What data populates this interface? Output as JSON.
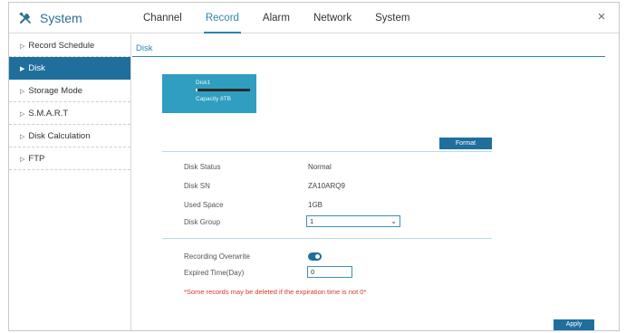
{
  "header": {
    "app_title": "System",
    "icon": "tools-icon",
    "nav": [
      "Channel",
      "Record",
      "Alarm",
      "Network",
      "System"
    ],
    "active_nav": "Record",
    "close_symbol": "×"
  },
  "sidebar": {
    "items": [
      {
        "label": "Record Schedule",
        "active": false
      },
      {
        "label": "Disk",
        "active": true
      },
      {
        "label": "Storage Mode",
        "active": false
      },
      {
        "label": "S.M.A.R.T",
        "active": false
      },
      {
        "label": "Disk Calculation",
        "active": false
      },
      {
        "label": "FTP",
        "active": false
      }
    ]
  },
  "main": {
    "section_title": "Disk",
    "disk_card": {
      "name": "Disk1",
      "capacity": "Capacity 8TB",
      "used_fraction": 0.04
    },
    "format_label": "Format",
    "info": {
      "status_label": "Disk Status",
      "status_value": "Normal",
      "sn_label": "Disk SN",
      "sn_value": "ZA10ARQ9",
      "used_label": "Used Space",
      "used_value": "1GB",
      "group_label": "Disk Group",
      "group_value": "1"
    },
    "overwrite_label": "Recording Overwrite",
    "overwrite_enabled": true,
    "expired_label": "Expired Time(Day)",
    "expired_value": "0",
    "warning": "*Some records may be deleted if the expiration time is not 0*",
    "apply_label": "Apply"
  },
  "colors": {
    "accent": "#2a86b4",
    "dark_blue": "#1f6f9d",
    "card": "#2f9ec0",
    "warning": "#d33a2c"
  }
}
